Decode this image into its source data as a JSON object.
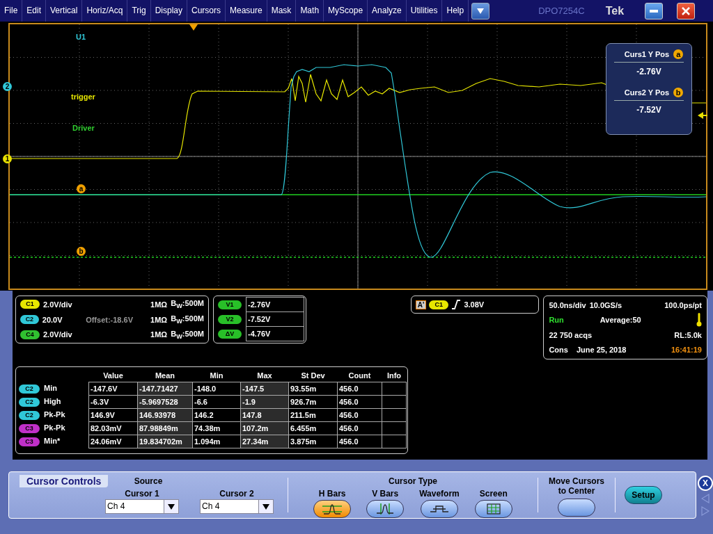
{
  "menu": [
    "File",
    "Edit",
    "Vertical",
    "Horiz/Acq",
    "Trig",
    "Display",
    "Cursors",
    "Measure",
    "Mask",
    "Math",
    "MyScope",
    "Analyze",
    "Utilities",
    "Help"
  ],
  "model": "DPO7254C",
  "brand": "Tek",
  "trace_labels": [
    {
      "text": "U1",
      "color": "#30c8d8"
    },
    {
      "text": "trigger",
      "color": "#e8e800"
    },
    {
      "text": "Driver",
      "color": "#30d030"
    }
  ],
  "markers": [
    {
      "kind": "channel",
      "text": "2",
      "color": "#30c8d8"
    },
    {
      "kind": "channel",
      "text": "1",
      "color": "#e8e000"
    },
    {
      "kind": "cursor",
      "text": "a",
      "color": "#f0a000"
    },
    {
      "kind": "cursor",
      "text": "b",
      "color": "#f0a000"
    }
  ],
  "cursor_readout": [
    {
      "label": "Curs1 Y Pos",
      "badge": "a",
      "value": "-2.76V"
    },
    {
      "label": "Curs2 Y Pos",
      "badge": "b",
      "value": "-7.52V"
    }
  ],
  "channels": [
    {
      "badge": "C1",
      "color": "#e6e600",
      "scale": "2.0V/div",
      "impedance": "1MΩ",
      "bandwidth": "B$_{W}$:500M"
    },
    {
      "badge": "C2",
      "color": "#30c8d8",
      "scale": "20.0V",
      "offset": "Offset:-18.6V",
      "impedance": "1MΩ",
      "bandwidth": "B$_{W}$:500M"
    },
    {
      "badge": "C4",
      "color": "#30c030",
      "scale": "2.0V/div",
      "impedance": "1MΩ",
      "bandwidth": "B$_{W}$:500M"
    }
  ],
  "cursor_values": [
    {
      "label": "V1",
      "value": "-2.76V"
    },
    {
      "label": "V2",
      "value": "-7.52V"
    },
    {
      "label": "ΔV",
      "value": "-4.76V"
    }
  ],
  "trigger": {
    "source": "A'",
    "badge": "C1",
    "color": "#e6e600",
    "threshold": "3.08V"
  },
  "acquisition": {
    "time_scale": "50.0ns/div",
    "sample_rate": "10.0GS/s",
    "resolution": "100.0ps/pt",
    "state": "Run",
    "mode": "Average:50",
    "acqs": "22 750 acqs",
    "record_length": "RL:5.0k",
    "source": "Cons",
    "date": "June 25, 2018",
    "time": "16:41:19"
  },
  "measurements": {
    "columns": [
      "Value",
      "Mean",
      "Min",
      "Max",
      "St Dev",
      "Count",
      "Info"
    ],
    "rows": [
      {
        "badge": "C2",
        "color": "#30c8d8",
        "name": "Min",
        "cells": [
          "-147.6V",
          "-147.71427",
          "-148.0",
          "-147.5",
          "93.55m",
          "456.0"
        ]
      },
      {
        "badge": "C2",
        "color": "#30c8d8",
        "name": "High",
        "cells": [
          "-6.3V",
          "-5.9697528",
          "-6.6",
          "-1.9",
          "926.7m",
          "456.0"
        ]
      },
      {
        "badge": "C2",
        "color": "#30c8d8",
        "name": "Pk-Pk",
        "cells": [
          "146.9V",
          "146.93978",
          "146.2",
          "147.8",
          "211.5m",
          "456.0"
        ]
      },
      {
        "badge": "C3",
        "color": "#c030c8",
        "name": "Pk-Pk",
        "cells": [
          "82.03mV",
          "87.98849m",
          "74.38m",
          "107.2m",
          "6.455m",
          "456.0"
        ]
      },
      {
        "badge": "C3",
        "color": "#c030c8",
        "name": "Min*",
        "cells": [
          "24.06mV",
          "19.834702m",
          "1.094m",
          "27.34m",
          "3.875m",
          "456.0"
        ]
      }
    ]
  },
  "cursor_controls": {
    "title": "Cursor Controls",
    "source_heading": "Source",
    "cursors": [
      {
        "label": "Cursor 1",
        "value": "Ch 4"
      },
      {
        "label": "Cursor 2",
        "value": "Ch 4"
      }
    ],
    "type_heading": "Cursor Type",
    "types": [
      {
        "label": "H Bars",
        "kind": "hbars",
        "selected": true
      },
      {
        "label": "V Bars",
        "kind": "vbars",
        "selected": false
      },
      {
        "label": "Waveform",
        "kind": "waveform",
        "selected": false
      },
      {
        "label": "Screen",
        "kind": "screen",
        "selected": false
      }
    ],
    "move_label": "Move Cursors to Center",
    "setup": "Setup",
    "close": "X"
  }
}
